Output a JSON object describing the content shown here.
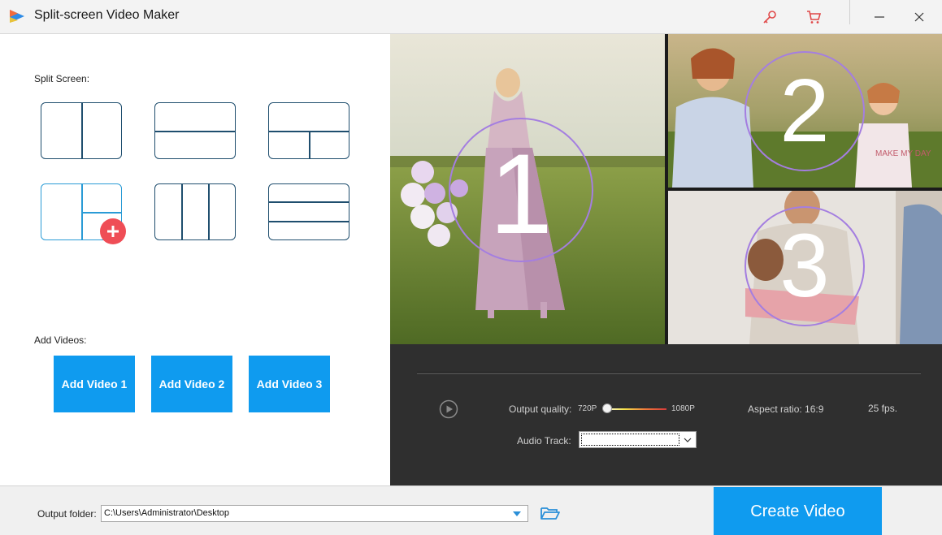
{
  "window": {
    "title": "Split-screen Video Maker"
  },
  "titlebar": {
    "icons": [
      "key-icon",
      "cart-icon",
      "minimize-icon",
      "close-icon"
    ]
  },
  "left": {
    "split_label": "Split Screen:",
    "layouts": [
      {
        "name": "two-columns"
      },
      {
        "name": "two-rows"
      },
      {
        "name": "top-plus-two-bottom"
      },
      {
        "name": "left-plus-two-right",
        "selected": true
      },
      {
        "name": "three-columns"
      },
      {
        "name": "three-rows"
      }
    ],
    "add_label": "Add Videos:",
    "add_buttons": [
      "Add Video 1",
      "Add Video 2",
      "Add Video 3"
    ]
  },
  "preview": {
    "panes": [
      {
        "number": "1",
        "scene": "girl-in-dress-field"
      },
      {
        "number": "2",
        "scene": "mother-daughter-dandelions"
      },
      {
        "number": "3",
        "scene": "father-child-play"
      }
    ]
  },
  "controls": {
    "output_quality_label": "Output quality:",
    "quality_min": "720P",
    "quality_max": "1080P",
    "quality_value": 0,
    "aspect_ratio": "Aspect ratio: 16:9",
    "fps": "25 fps.",
    "audio_track_label": "Audio Track:",
    "audio_track_value": ""
  },
  "bottom": {
    "output_folder_label": "Output folder:",
    "output_folder_value": "C:\\Users\\Administrator\\Desktop",
    "create_label": "Create Video"
  },
  "colors": {
    "accent": "#0f9bef",
    "layout_border": "#1f4e6e",
    "selected_border": "#2a9bd6",
    "plus_badge": "#ef4d56",
    "controls_bg": "#2f2f2f",
    "number_ring": "#a47ee0"
  }
}
